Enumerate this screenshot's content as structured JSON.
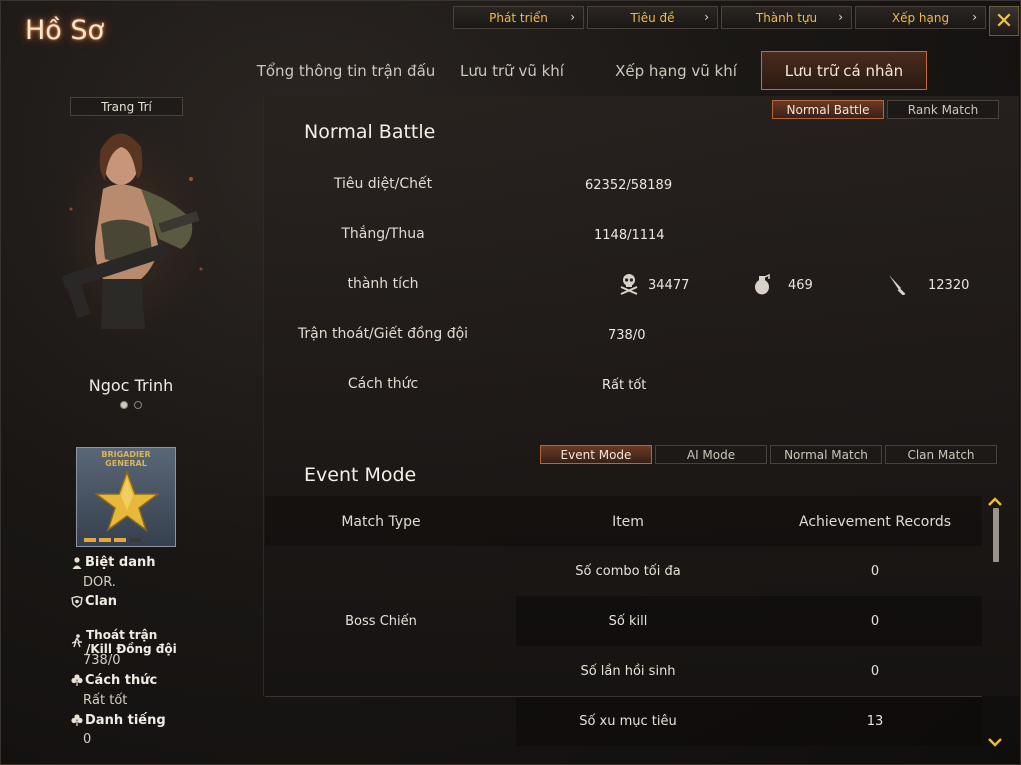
{
  "window": {
    "title": "Hồ Sơ",
    "close_label": "✕"
  },
  "topnav": [
    {
      "label": "Phát triển",
      "chevron": "›"
    },
    {
      "label": "Tiêu đề",
      "chevron": "›"
    },
    {
      "label": "Thành tựu",
      "chevron": "›"
    },
    {
      "label": "Xếp hạng",
      "chevron": "›"
    }
  ],
  "tabs": [
    {
      "label": "Tổng thông tin trận đấu",
      "active": false
    },
    {
      "label": "Lưu trữ vũ khí",
      "active": false
    },
    {
      "label": "Xếp hạng vũ khí",
      "active": false
    },
    {
      "label": "Lưu trữ cá nhân",
      "active": true
    }
  ],
  "left": {
    "decorate_label": "Trang Trí",
    "character_name": "Ngoc Trinh",
    "rank_text_1": "BRIGADIER",
    "rank_text_2": "GENERAL",
    "rank_progress_bars": 4,
    "rank_progress_filled": 3,
    "nickname_label": "Biệt danh",
    "nickname_value": "DOR.",
    "clan_label": "Clan",
    "escape_label_1": "Thoát trận",
    "escape_label_2": "/Kill Đồng đội",
    "escape_value": "738/0",
    "manner_label": "Cách thức",
    "manner_value": "Rất tốt",
    "fame_label": "Danh tiếng",
    "fame_value": "0"
  },
  "battle_modes": {
    "normal": "Normal Battle",
    "rank": "Rank Match",
    "active": "normal"
  },
  "normal_battle": {
    "title": "Normal Battle",
    "kd_label": "Tiêu diệt/Chết",
    "kd_value": "62352/58189",
    "wl_label": "Thắng/Thua",
    "wl_value": "1148/1114",
    "achievement_label": "thành tích",
    "headshot_value": "34477",
    "grenade_value": "469",
    "knife_value": "12320",
    "escape_label": "Trận thoát/Giết đồng đội",
    "escape_value": "738/0",
    "manner_label": "Cách thức",
    "manner_value": "Rất tốt"
  },
  "event_modes": [
    "Event Mode",
    "AI Mode",
    "Normal Match",
    "Clan Match"
  ],
  "event": {
    "title": "Event Mode",
    "headers": {
      "match_type": "Match Type",
      "item": "Item",
      "records": "Achievement Records"
    },
    "match_type": "Boss Chiến",
    "rows": [
      {
        "item": "Số combo tối đa",
        "value": "0"
      },
      {
        "item": "Số kill",
        "value": "0"
      },
      {
        "item": "Số lần hồi sinh",
        "value": "0"
      },
      {
        "item": "Số xu mục tiêu",
        "value": "13"
      }
    ]
  },
  "icons": {
    "skull": "skull-crossbones-icon",
    "grenade": "grenade-icon",
    "knife": "knife-icon",
    "person": "person-icon",
    "clan": "clan-shield-icon",
    "running": "running-person-icon",
    "clover": "clover-icon",
    "scroll_up": "chevron-up-icon",
    "scroll_down": "chevron-down-icon"
  },
  "colors": {
    "accent": "#f2b84a",
    "active_tab_border": "#c26a3a",
    "title_glow": "#ff7828"
  }
}
